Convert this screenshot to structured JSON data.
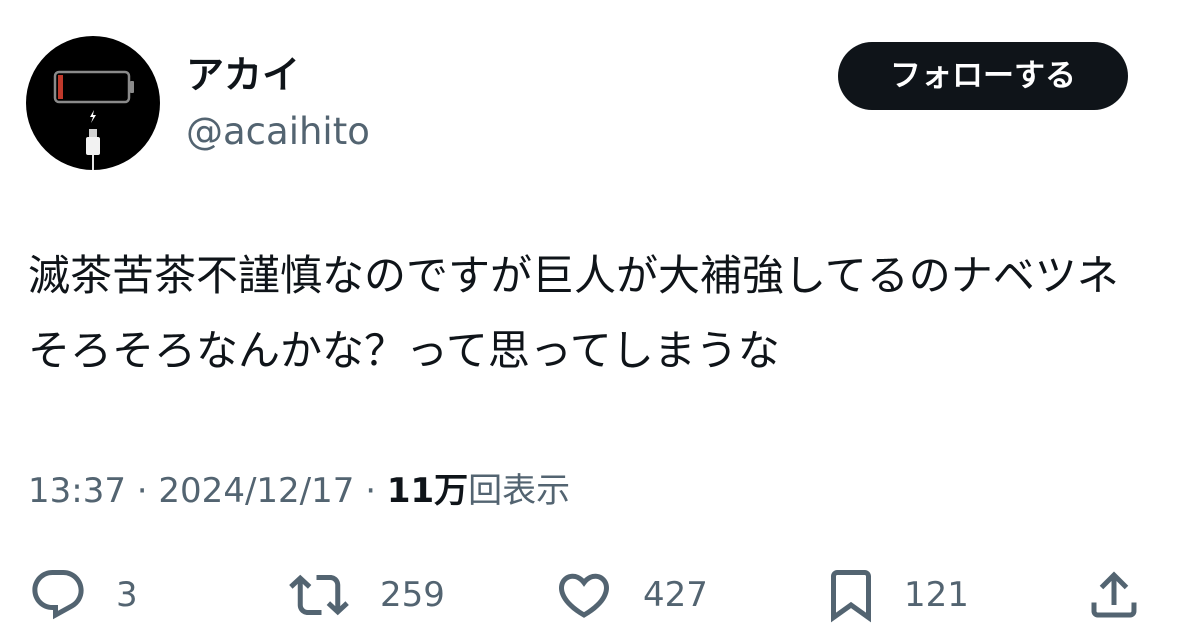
{
  "user": {
    "display_name": "アカイ",
    "handle": "@acaihito",
    "avatar_icon": "empty-battery-charging-icon"
  },
  "follow_button": {
    "label": "フォローする"
  },
  "tweet": {
    "text": "滅茶苦茶不謹慎なのですが巨人が大補強してるのナベツネそろそろなんかな？って思ってしまうな",
    "time": "13:37",
    "separator": " · ",
    "date": "2024/12/17",
    "views_count": "11万",
    "views_label": "回表示"
  },
  "actions": {
    "reply": {
      "icon": "reply-icon",
      "count": "3"
    },
    "retweet": {
      "icon": "retweet-icon",
      "count": "259"
    },
    "like": {
      "icon": "heart-icon",
      "count": "427"
    },
    "bookmark": {
      "icon": "bookmark-icon",
      "count": "121"
    },
    "share": {
      "icon": "share-icon"
    }
  },
  "colors": {
    "text_primary": "#0f1419",
    "text_secondary": "#536471",
    "follow_button_bg": "#0f1419",
    "battery_red": "#c0392b"
  }
}
